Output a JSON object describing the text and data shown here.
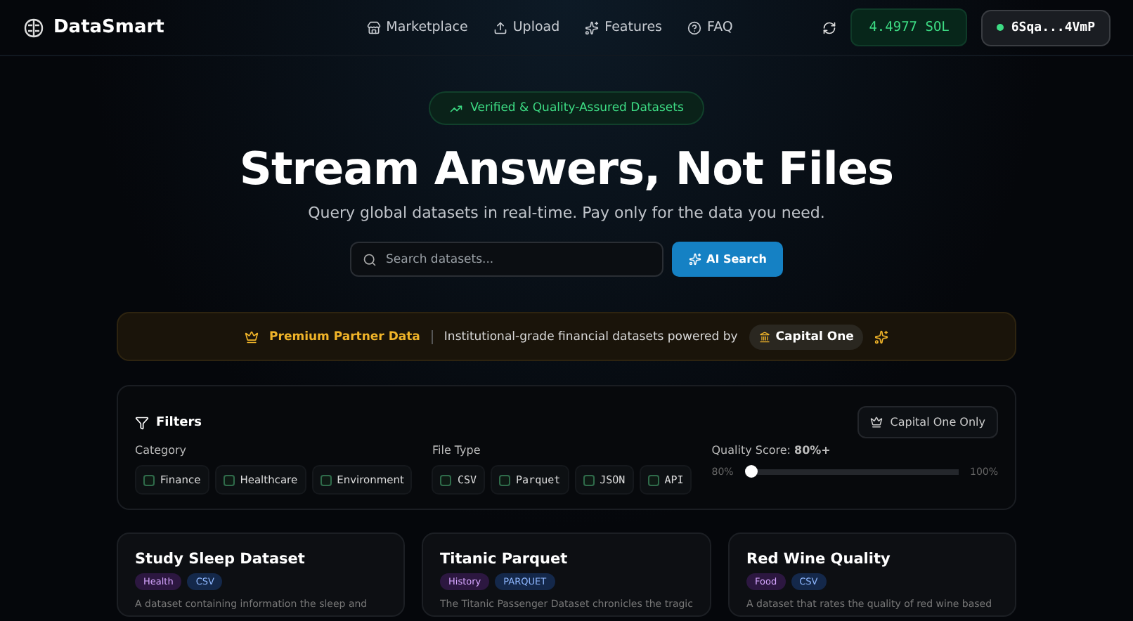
{
  "brand": "DataSmart",
  "nav": [
    {
      "label": "Marketplace"
    },
    {
      "label": "Upload"
    },
    {
      "label": "Features"
    },
    {
      "label": "FAQ"
    }
  ],
  "balance": "4.4977 SOL",
  "wallet": "6Sqa...4VmP",
  "hero": {
    "badge": "Verified & Quality-Assured Datasets",
    "title": "Stream Answers, Not Files",
    "subtitle": "Query global datasets in real-time. Pay only for the data you need.",
    "search_placeholder": "Search datasets...",
    "search_button": "AI Search"
  },
  "partner": {
    "label": "Premium Partner Data",
    "text": "Institutional-grade financial datasets powered by",
    "partner": "Capital One"
  },
  "filters": {
    "title": "Filters",
    "partner_toggle": "Capital One Only",
    "category": {
      "label": "Category",
      "options": [
        {
          "label": "Finance",
          "checked": false
        },
        {
          "label": "Healthcare",
          "checked": false
        },
        {
          "label": "Environment",
          "checked": false
        }
      ]
    },
    "file_type": {
      "label": "File Type",
      "options": [
        {
          "label": "CSV",
          "checked": false
        },
        {
          "label": "Parquet",
          "checked": false
        },
        {
          "label": "JSON",
          "checked": false
        },
        {
          "label": "API",
          "checked": false
        }
      ]
    },
    "quality": {
      "label": "Quality Score:",
      "value": "80%+",
      "min": "80%",
      "max": "100%",
      "level": 0
    }
  },
  "cards": [
    {
      "title": "Study Sleep Dataset",
      "tags": [
        {
          "label": "Health",
          "kind": "category"
        },
        {
          "label": "CSV",
          "kind": "format"
        }
      ],
      "description": "A dataset containing information the sleep and"
    },
    {
      "title": "Titanic Parquet",
      "tags": [
        {
          "label": "History",
          "kind": "category"
        },
        {
          "label": "PARQUET",
          "kind": "format"
        }
      ],
      "description": "The Titanic Passenger Dataset chronicles the tragic"
    },
    {
      "title": "Red Wine Quality",
      "tags": [
        {
          "label": "Food",
          "kind": "category"
        },
        {
          "label": "CSV",
          "kind": "format"
        }
      ],
      "description": "A dataset that rates the quality of red wine based"
    }
  ]
}
